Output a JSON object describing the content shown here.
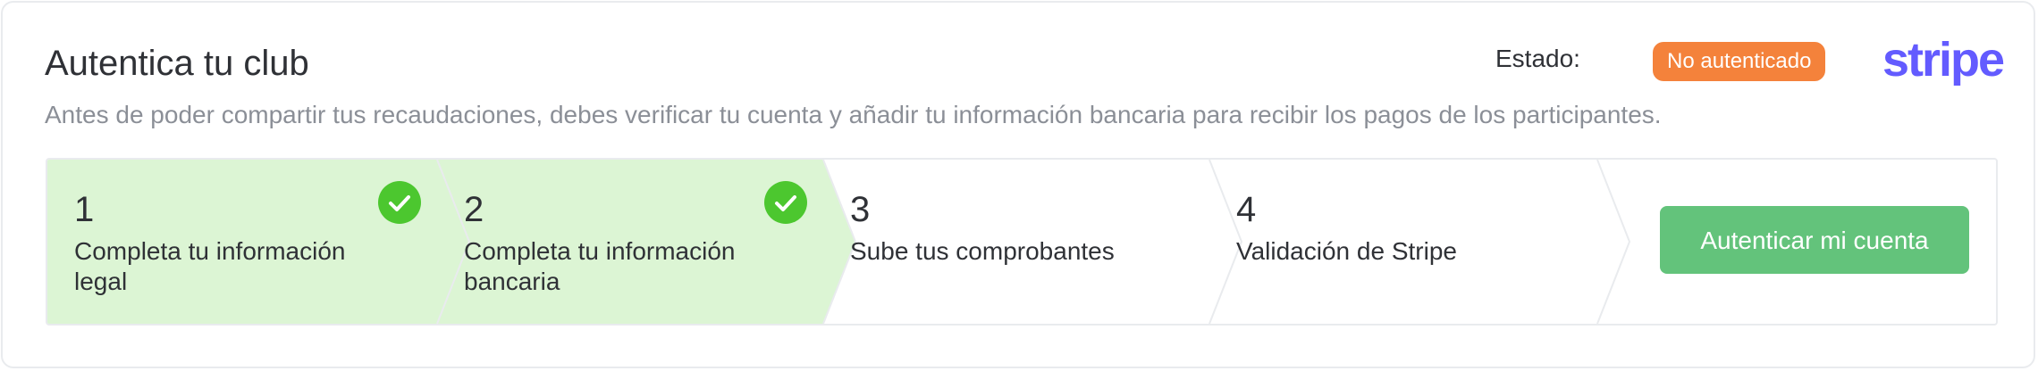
{
  "header": {
    "title": "Autentica tu club",
    "subtitle": "Antes de poder compartir tus recaudaciones, debes verificar tu cuenta y añadir tu información bancaria para recibir los pagos de los participantes.",
    "status_label": "Estado:",
    "status_value": "No autenticado",
    "logo_text": "stripe"
  },
  "steps": [
    {
      "number": "1",
      "label": "Completa tu información legal",
      "completed": true
    },
    {
      "number": "2",
      "label": "Completa tu información bancaria",
      "completed": true
    },
    {
      "number": "3",
      "label": "Sube tus comprobantes",
      "completed": false
    },
    {
      "number": "4",
      "label": "Validación de Stripe",
      "completed": false
    }
  ],
  "action": {
    "label": "Autenticar mi cuenta"
  },
  "colors": {
    "completed_bg": "#dcf5d4",
    "check": "#4cc72f",
    "badge": "#f4823b",
    "button": "#63c37b",
    "brand": "#635bff"
  }
}
